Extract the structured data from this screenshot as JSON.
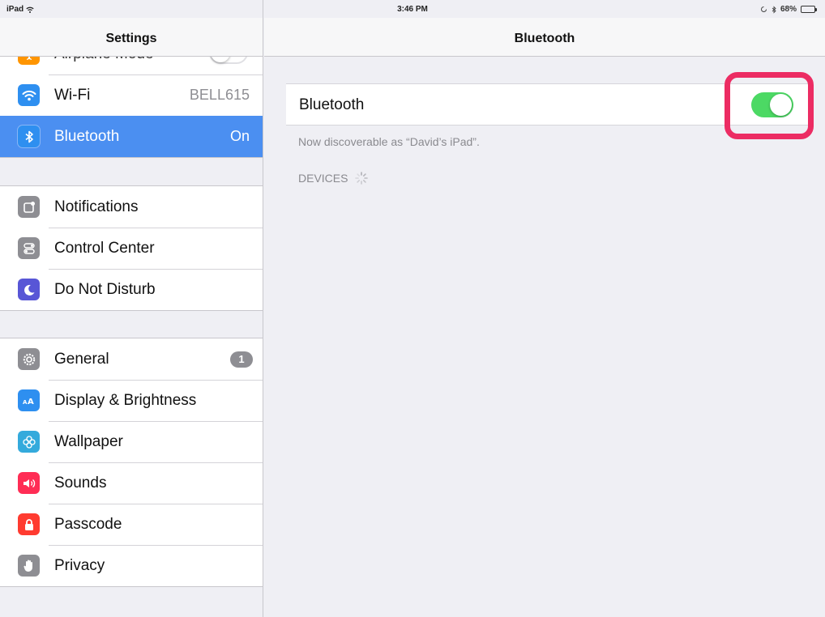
{
  "status_bar": {
    "device": "iPad",
    "time": "3:46 PM",
    "battery": "68%",
    "battery_level": 0.68
  },
  "sidebar": {
    "title": "Settings",
    "groups": [
      {
        "items": [
          {
            "label": "Airplane Mode",
            "icon": "airplane-icon",
            "color": "#ff9500"
          },
          {
            "label": "Wi-Fi",
            "value": "BELL615",
            "icon": "wifi-icon",
            "color": "#2e8ff0"
          },
          {
            "label": "Bluetooth",
            "value": "On",
            "icon": "bluetooth-icon",
            "color": "#2e8ff0",
            "selected": true
          }
        ]
      },
      {
        "items": [
          {
            "label": "Notifications",
            "icon": "notifications-icon",
            "color": "#8e8e93"
          },
          {
            "label": "Control Center",
            "icon": "control-center-icon",
            "color": "#8e8e93"
          },
          {
            "label": "Do Not Disturb",
            "icon": "moon-icon",
            "color": "#5856d6"
          }
        ]
      },
      {
        "items": [
          {
            "label": "General",
            "badge": "1",
            "icon": "gear-icon",
            "color": "#8e8e93"
          },
          {
            "label": "Display & Brightness",
            "icon": "display-icon",
            "color": "#2e8ff0"
          },
          {
            "label": "Wallpaper",
            "icon": "wallpaper-icon",
            "color": "#34aadc"
          },
          {
            "label": "Sounds",
            "icon": "speaker-icon",
            "color": "#ff2d55"
          },
          {
            "label": "Passcode",
            "icon": "lock-icon",
            "color": "#ff3b30"
          },
          {
            "label": "Privacy",
            "icon": "hand-icon",
            "color": "#8e8e93"
          }
        ]
      }
    ]
  },
  "detail": {
    "title": "Bluetooth",
    "bluetooth_label": "Bluetooth",
    "bluetooth_on": true,
    "switch_color": "#4cd964",
    "highlight_color": "#ec2c63",
    "discoverable_text": "Now discoverable as “David’s iPad”.",
    "devices_header": "DEVICES"
  }
}
